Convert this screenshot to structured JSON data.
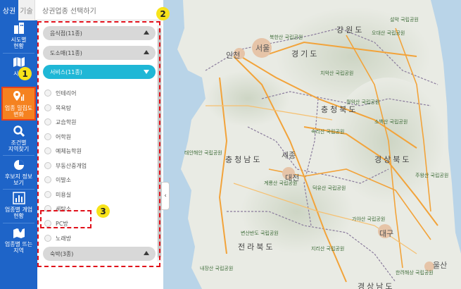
{
  "tabs": {
    "active": "상권",
    "inactive": "기술"
  },
  "header": {
    "title": "상권업종 선택하기"
  },
  "nav": {
    "items": [
      {
        "label_1": "시도별",
        "label_2": "현황",
        "icon": "building-icon"
      },
      {
        "label_1": "시군",
        "label_2": "",
        "icon": "map-icon"
      },
      {
        "label_1": "업종 밀집도",
        "label_2": "변화",
        "icon": "location-chart-icon"
      },
      {
        "label_1": "조건별",
        "label_2": "지역찾기",
        "icon": "search-icon"
      },
      {
        "label_1": "후보지 정보",
        "label_2": "보기",
        "icon": "pie-chart-icon"
      },
      {
        "label_1": "업종별 개업",
        "label_2": "현황",
        "icon": "bar-chart-icon"
      },
      {
        "label_1": "업종별 뜨는",
        "label_2": "지역",
        "icon": "map-pin-icon"
      }
    ]
  },
  "categories": [
    {
      "label": "음식점(11종)",
      "state": "collapsed"
    },
    {
      "label": "도소매(11종)",
      "state": "collapsed"
    },
    {
      "label": "서비스(11종)",
      "state": "expanded"
    },
    {
      "label": "숙박(3종)",
      "state": "collapsed"
    }
  ],
  "subcategories": [
    "인테리어",
    "목욕탕",
    "교습학원",
    "어학원",
    "예체능학원",
    "부동산중개업",
    "이발소",
    "미용실",
    "세탁소",
    "PC방",
    "노래방"
  ],
  "annotations": [
    "1",
    "2",
    "3"
  ],
  "map": {
    "regions": [
      "강원도",
      "경기도",
      "충청북도",
      "충청남도",
      "경상북도",
      "전라북도",
      "경상남도"
    ],
    "cities": [
      "인천",
      "서울",
      "세종",
      "대전",
      "대구",
      "울산"
    ],
    "parks": [
      "오대산 국립공원",
      "설악 국립공원",
      "북한산 국립공원",
      "치악산 국립공원",
      "월악산 국립공원",
      "소백산 국립공원",
      "속리산 국립공원",
      "태안해안 국립공원",
      "계룡산 국립공원",
      "덕유산 국립공원",
      "주왕산 국립공원",
      "가야산 국립공원",
      "지리산 국립공원",
      "변산반도 국립공원",
      "내장산 국립공원",
      "한려해상 국립공원"
    ],
    "highways": [
      "1",
      "15",
      "30",
      "35",
      "40",
      "45",
      "50",
      "55",
      "65"
    ]
  },
  "colors": {
    "nav_bg": "#1e64c8",
    "nav_active": "#f58220",
    "category_open": "#1fb7d6",
    "annotation_red": "#e0101a",
    "badge_yellow": "#f7e31a"
  }
}
